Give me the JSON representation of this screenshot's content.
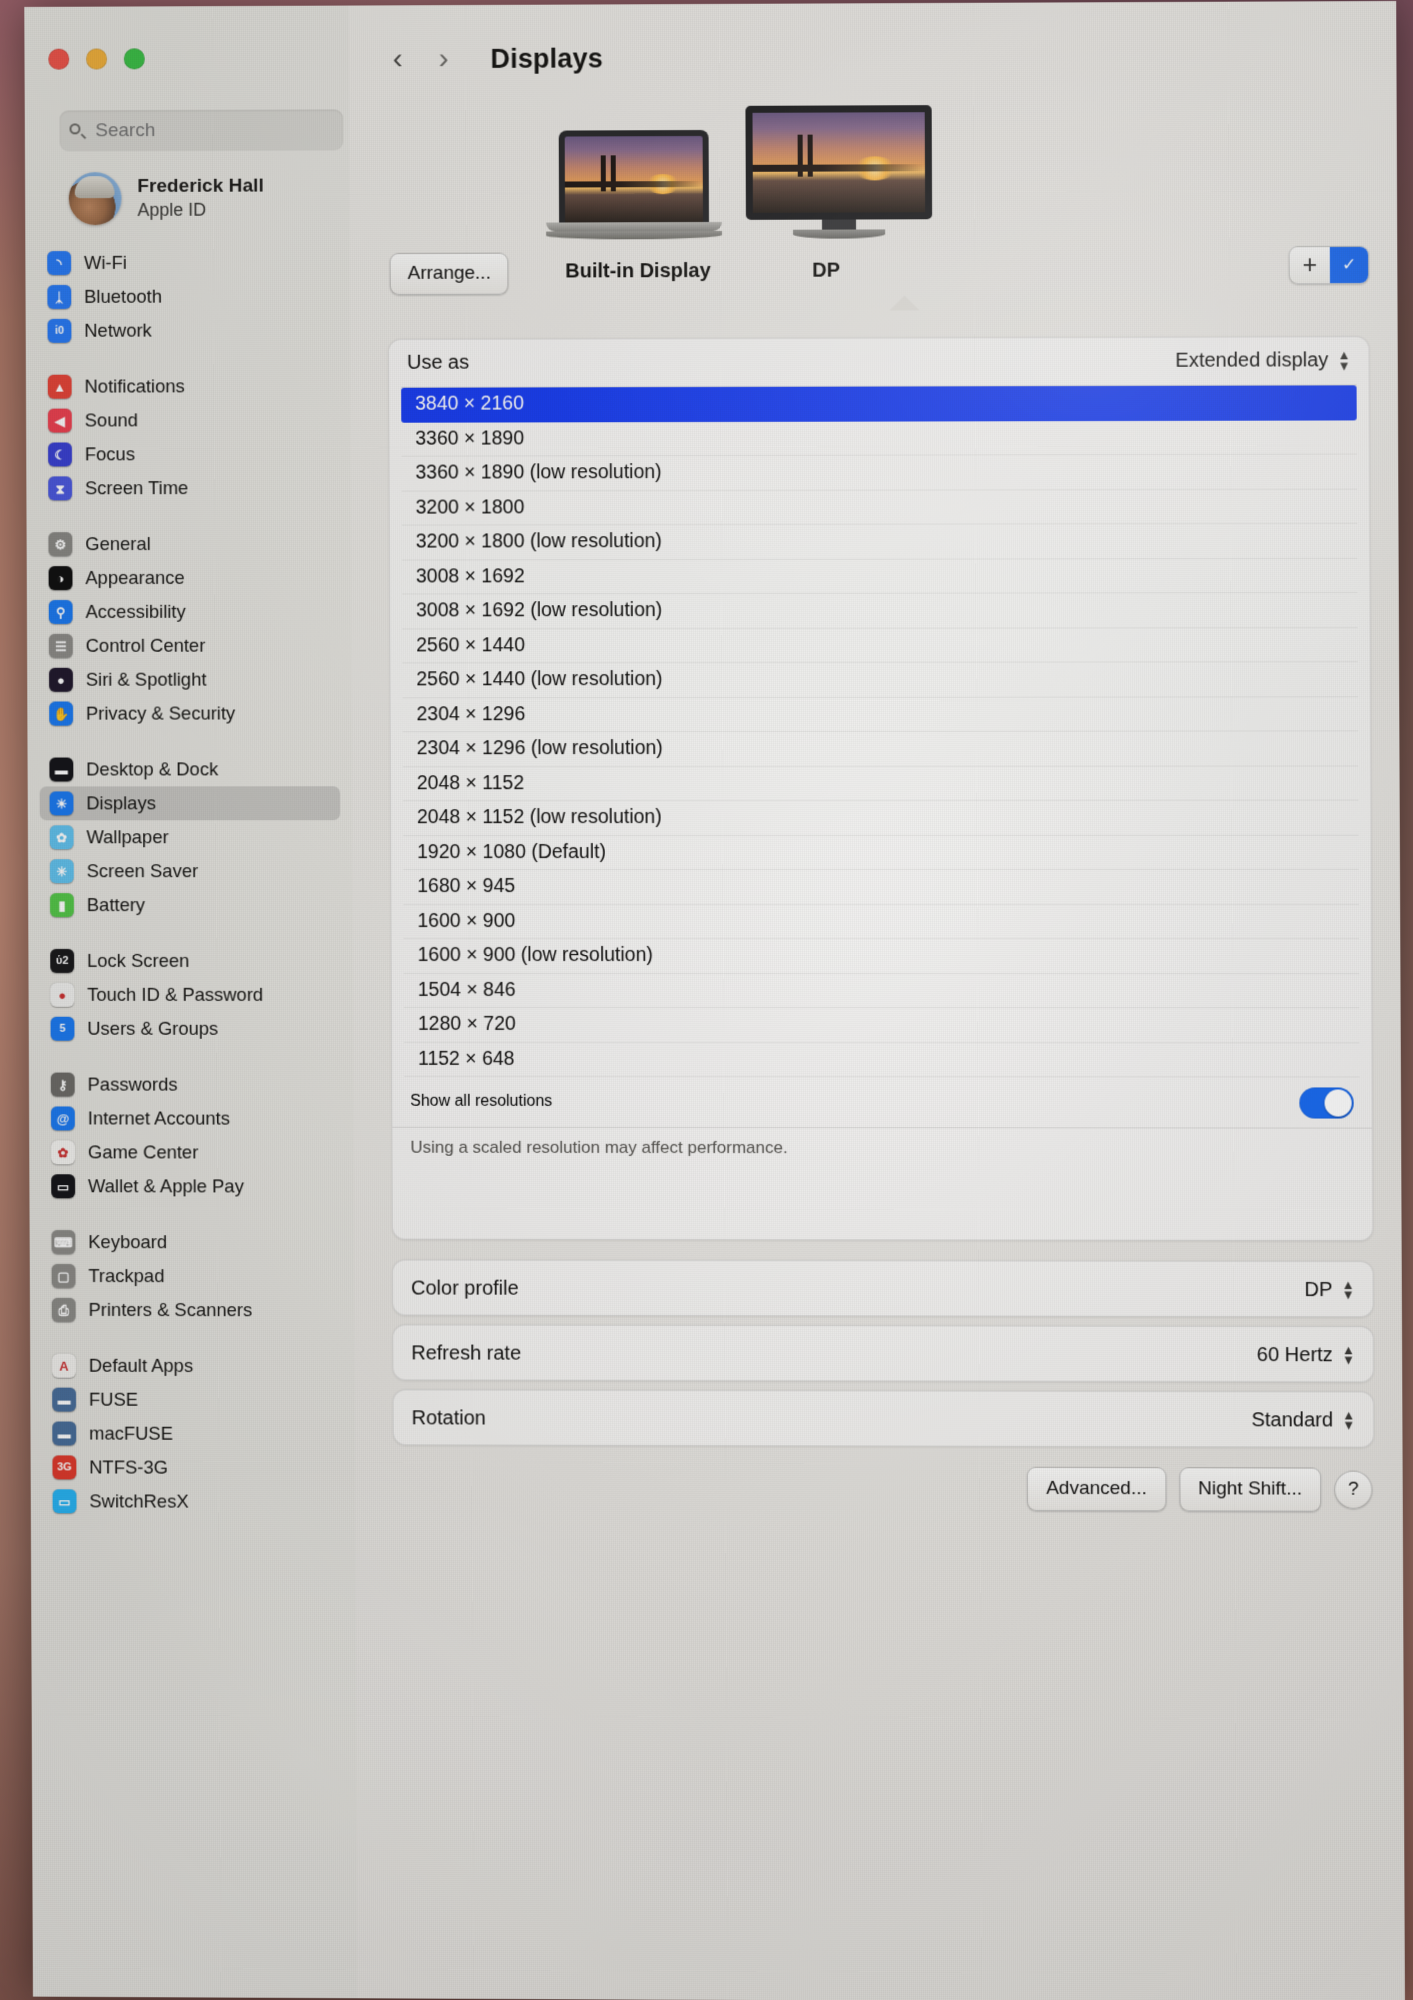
{
  "window": {
    "title": "Displays",
    "traffic_lights": [
      "close",
      "minimize",
      "zoom"
    ]
  },
  "search": {
    "placeholder": "Search"
  },
  "account": {
    "name": "Frederick Hall",
    "subtitle": "Apple ID"
  },
  "sidebar": {
    "groups": [
      {
        "items": [
          {
            "label": "Wi-Fi",
            "icon": "wifi-icon",
            "color": "#2a7cf7",
            "glyph": "◝"
          },
          {
            "label": "Bluetooth",
            "icon": "bluetooth-icon",
            "color": "#2a7cf7",
            "glyph": "ᛣ"
          },
          {
            "label": "Network",
            "icon": "network-icon",
            "color": "#2a7cf7",
            "glyph": "ἱ0"
          }
        ]
      },
      {
        "items": [
          {
            "label": "Notifications",
            "icon": "notifications-icon",
            "color": "#e8463a",
            "glyph": "▲"
          },
          {
            "label": "Sound",
            "icon": "sound-icon",
            "color": "#ef4352",
            "glyph": "◀"
          },
          {
            "label": "Focus",
            "icon": "focus-icon",
            "color": "#3b42d4",
            "glyph": "☾"
          },
          {
            "label": "Screen Time",
            "icon": "screen-time-icon",
            "color": "#4d5ae0",
            "glyph": "⧗"
          }
        ]
      },
      {
        "items": [
          {
            "label": "General",
            "icon": "general-gear-icon",
            "color": "#8b8a86",
            "glyph": "⚙"
          },
          {
            "label": "Appearance",
            "icon": "appearance-icon",
            "color": "#111111",
            "glyph": "◑"
          },
          {
            "label": "Accessibility",
            "icon": "accessibility-icon",
            "color": "#1d7bf2",
            "glyph": "⚲"
          },
          {
            "label": "Control Center",
            "icon": "control-center-icon",
            "color": "#8e8d89",
            "glyph": "☰"
          },
          {
            "label": "Siri & Spotlight",
            "icon": "siri-icon",
            "color": "#221a2e",
            "glyph": "●"
          },
          {
            "label": "Privacy & Security",
            "icon": "privacy-icon",
            "color": "#1d7bf2",
            "glyph": "✋"
          }
        ]
      },
      {
        "items": [
          {
            "label": "Desktop & Dock",
            "icon": "desktop-dock-icon",
            "color": "#16161a",
            "glyph": "▬"
          },
          {
            "label": "Displays",
            "icon": "displays-icon",
            "color": "#1d7bf2",
            "glyph": "☀",
            "selected": true
          },
          {
            "label": "Wallpaper",
            "icon": "wallpaper-icon",
            "color": "#63c3ef",
            "glyph": "✿"
          },
          {
            "label": "Screen Saver",
            "icon": "screen-saver-icon",
            "color": "#63c3ef",
            "glyph": "✳"
          },
          {
            "label": "Battery",
            "icon": "battery-icon",
            "color": "#55c84a",
            "glyph": "▮"
          }
        ]
      },
      {
        "items": [
          {
            "label": "Lock Screen",
            "icon": "lock-screen-icon",
            "color": "#1a1a1c",
            "glyph": "ὑ2"
          },
          {
            "label": "Touch ID & Password",
            "icon": "touch-id-icon",
            "color": "#f0f0ee",
            "glyph": "●"
          },
          {
            "label": "Users & Groups",
            "icon": "users-groups-icon",
            "color": "#1d7bf2",
            "glyph": "὆5"
          }
        ]
      },
      {
        "items": [
          {
            "label": "Passwords",
            "icon": "passwords-key-icon",
            "color": "#6e6d69",
            "glyph": "⚷"
          },
          {
            "label": "Internet Accounts",
            "icon": "internet-accounts-icon",
            "color": "#1d7bf2",
            "glyph": "@"
          },
          {
            "label": "Game Center",
            "icon": "game-center-icon",
            "color": "#f5f4f1",
            "glyph": "✿"
          },
          {
            "label": "Wallet & Apple Pay",
            "icon": "wallet-icon",
            "color": "#16161a",
            "glyph": "▭"
          }
        ]
      },
      {
        "items": [
          {
            "label": "Keyboard",
            "icon": "keyboard-icon",
            "color": "#8e8d89",
            "glyph": "⌨"
          },
          {
            "label": "Trackpad",
            "icon": "trackpad-icon",
            "color": "#8e8d89",
            "glyph": "▢"
          },
          {
            "label": "Printers & Scanners",
            "icon": "printers-scanners-icon",
            "color": "#8e8d89",
            "glyph": "⎙"
          }
        ]
      },
      {
        "items": [
          {
            "label": "Default Apps",
            "icon": "default-apps-icon",
            "color": "#f2f1ee",
            "glyph": "A"
          },
          {
            "label": "FUSE",
            "icon": "fuse-icon",
            "color": "#4a6f9c",
            "glyph": "▬"
          },
          {
            "label": "macFUSE",
            "icon": "macfuse-icon",
            "color": "#4a6f9c",
            "glyph": "▬"
          },
          {
            "label": "NTFS-3G",
            "icon": "ntfs-3g-icon",
            "color": "#e23b2e",
            "glyph": "3G"
          },
          {
            "label": "SwitchResX",
            "icon": "switchresx-icon",
            "color": "#29b6f6",
            "glyph": "▭"
          }
        ]
      }
    ]
  },
  "displays_header": {
    "arrange_label": "Arrange...",
    "displays": [
      {
        "name": "Built-in Display",
        "type": "laptop",
        "selected": false
      },
      {
        "name": "DP",
        "type": "external-monitor",
        "selected": true
      }
    ],
    "add_button": {
      "plus_label": "+",
      "check_glyph": "✓",
      "accent": "#1767f0"
    }
  },
  "use_as": {
    "label": "Use as",
    "value": "Extended display"
  },
  "resolutions": {
    "selected_index": 0,
    "items": [
      "3840 × 2160",
      "3360 × 1890",
      "3360 × 1890 (low resolution)",
      "3200 × 1800",
      "3200 × 1800 (low resolution)",
      "3008 × 1692",
      "3008 × 1692 (low resolution)",
      "2560 × 1440",
      "2560 × 1440 (low resolution)",
      "2304 × 1296",
      "2304 × 1296 (low resolution)",
      "2048 × 1152",
      "2048 × 1152 (low resolution)",
      "1920 × 1080 (Default)",
      "1680 × 945",
      "1600 × 900",
      "1600 × 900 (low resolution)",
      "1504 × 846",
      "1280 × 720",
      "1152 × 648"
    ]
  },
  "show_all": {
    "label": "Show all resolutions",
    "on": true,
    "note": "Using a scaled resolution may affect performance."
  },
  "color_profile": {
    "label": "Color profile",
    "value": "DP"
  },
  "refresh_rate": {
    "label": "Refresh rate",
    "value": "60 Hertz"
  },
  "rotation": {
    "label": "Rotation",
    "value": "Standard"
  },
  "footer_buttons": {
    "advanced": "Advanced...",
    "night_shift": "Night Shift...",
    "help": "?"
  }
}
